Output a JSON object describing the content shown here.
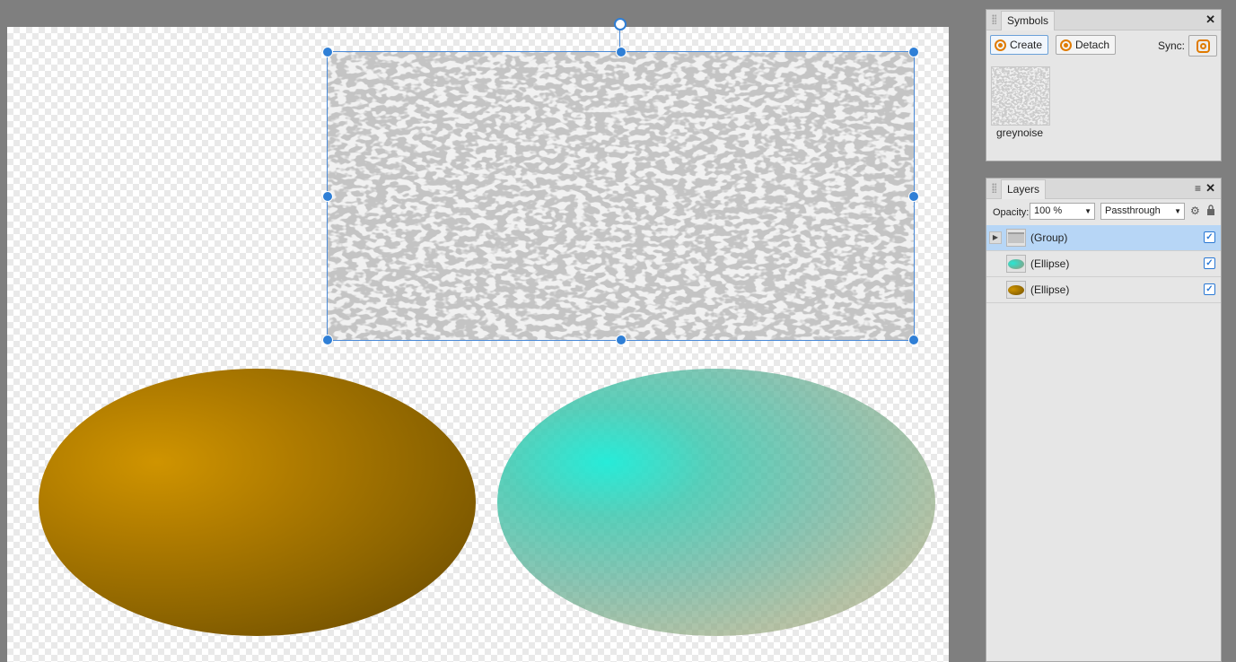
{
  "canvas": {
    "symbol_name": "greynoise",
    "objects": [
      "(Group)",
      "(Ellipse)",
      "(Ellipse)"
    ]
  },
  "symbols_panel": {
    "tab_label": "Symbols",
    "close_glyph": "✕",
    "create_label": "Create",
    "detach_label": "Detach",
    "sync_label": "Sync:",
    "symbol_name": "greynoise",
    "icons": [
      "grip-icon",
      "create-symbol-icon",
      "detach-symbol-icon",
      "sync-icon",
      "close-icon"
    ]
  },
  "layers_panel": {
    "tab_label": "Layers",
    "close_glyph": "✕",
    "menu_glyph": "≡",
    "opacity_label": "Opacity:",
    "opacity_value": "100 %",
    "blend_mode": "Passthrough",
    "caret": "▼",
    "layers": [
      {
        "name": "(Group)",
        "selected": true,
        "visible": true,
        "expander": "▶",
        "check": "✓"
      },
      {
        "name": "(Ellipse)",
        "selected": false,
        "visible": true,
        "check": "✓"
      },
      {
        "name": "(Ellipse)",
        "selected": false,
        "visible": true,
        "check": "✓"
      }
    ]
  },
  "colors": {
    "accent": "#2f7fd6",
    "selection_row": "#b7d6f6",
    "symbol_orange": "#e07b00",
    "gold": "#cf9400",
    "teal": "#20ebd7",
    "workspace": "#7f7f7f"
  }
}
